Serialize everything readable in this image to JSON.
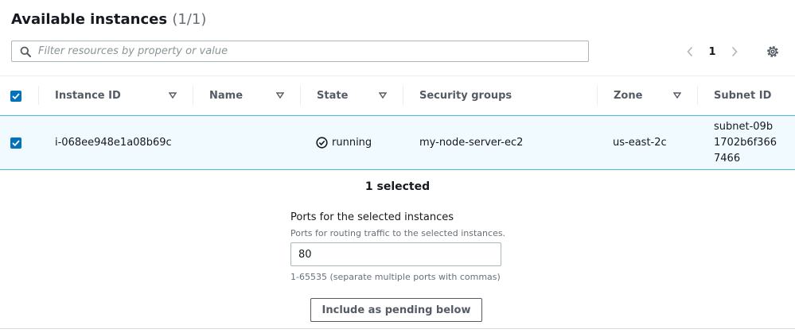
{
  "panel": {
    "title": "Available instances",
    "count": "(1/1)"
  },
  "filter": {
    "placeholder": "Filter resources by property or value",
    "value": "",
    "icon": "search-icon"
  },
  "pagination": {
    "current_page": "1",
    "prev_icon": "chevron-left-icon",
    "next_icon": "chevron-right-icon"
  },
  "settings_icon": "gear-icon",
  "table": {
    "columns": [
      "Instance ID",
      "Name",
      "State",
      "Security groups",
      "Zone",
      "Subnet ID"
    ],
    "rows": [
      {
        "selected": true,
        "instance_id": "i-068ee948e1a08b69c",
        "name": "",
        "state": "running",
        "security_groups": "my-node-server-ec2",
        "zone": "us-east-2c",
        "subnet_id": "subnet-09b1702b6f3667466"
      }
    ]
  },
  "selection": {
    "summary": "1 selected",
    "ports_label": "Ports for the selected instances",
    "ports_description": "Ports for routing traffic to the selected instances.",
    "ports_value": "80",
    "ports_hint": "1-65535 (separate multiple ports with commas)",
    "include_button": "Include as pending below"
  },
  "colors": {
    "accent": "#0073bb",
    "selected_row_bg": "#f1faff",
    "selected_row_border": "#44b9d6",
    "success": "#1d8102"
  }
}
